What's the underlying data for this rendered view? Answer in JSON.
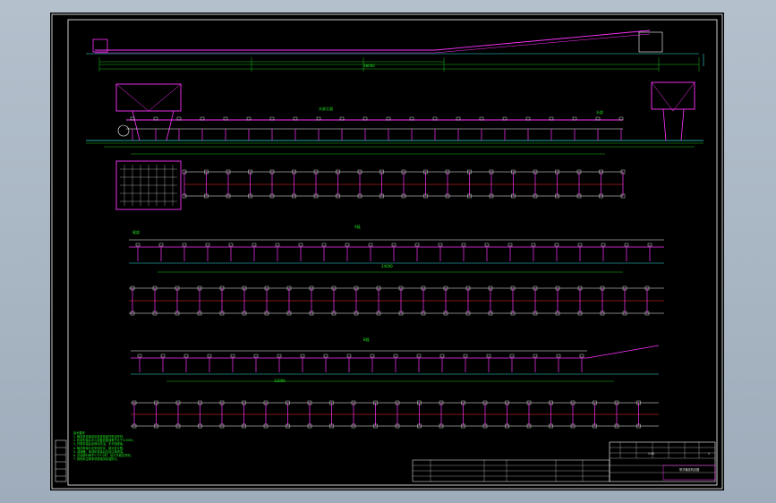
{
  "colors": {
    "background": "#a9b6c4",
    "sheet": "#000000",
    "frame": "#ffffff",
    "structure": "#ff33ff",
    "dimension": "#22ee22",
    "centerline": "#ff3333",
    "detail": "#33dddd"
  },
  "labels": {
    "view_top": "头部立面",
    "view_a": "A段",
    "view_b": "B段",
    "tail_label": "尾部",
    "head_label": "头部",
    "dim_total": "38000",
    "dim_span": "24000",
    "dim_seg": "12000"
  },
  "notes": [
    "技术要求",
    "1. 输送机安装前应检查各部件是否完好。",
    "2. 机架安装后中心线直线度误差不大于1/1000。",
    "3. 托辊安装后应转动灵活，无卡阻现象。",
    "4. 输送带接头应牢固可靠，接头处平整。",
    "5. 减速器、电动机安装后应加注润滑油。",
    "6. 试运转时间不少于2小时，运行平稳无异响。",
    "7. 其他未注明事项按相关标准执行。"
  ],
  "title_block": {
    "drawing_name": "带式输送机总图",
    "scale": "1:50",
    "sheet": "1",
    "company": "设计"
  }
}
